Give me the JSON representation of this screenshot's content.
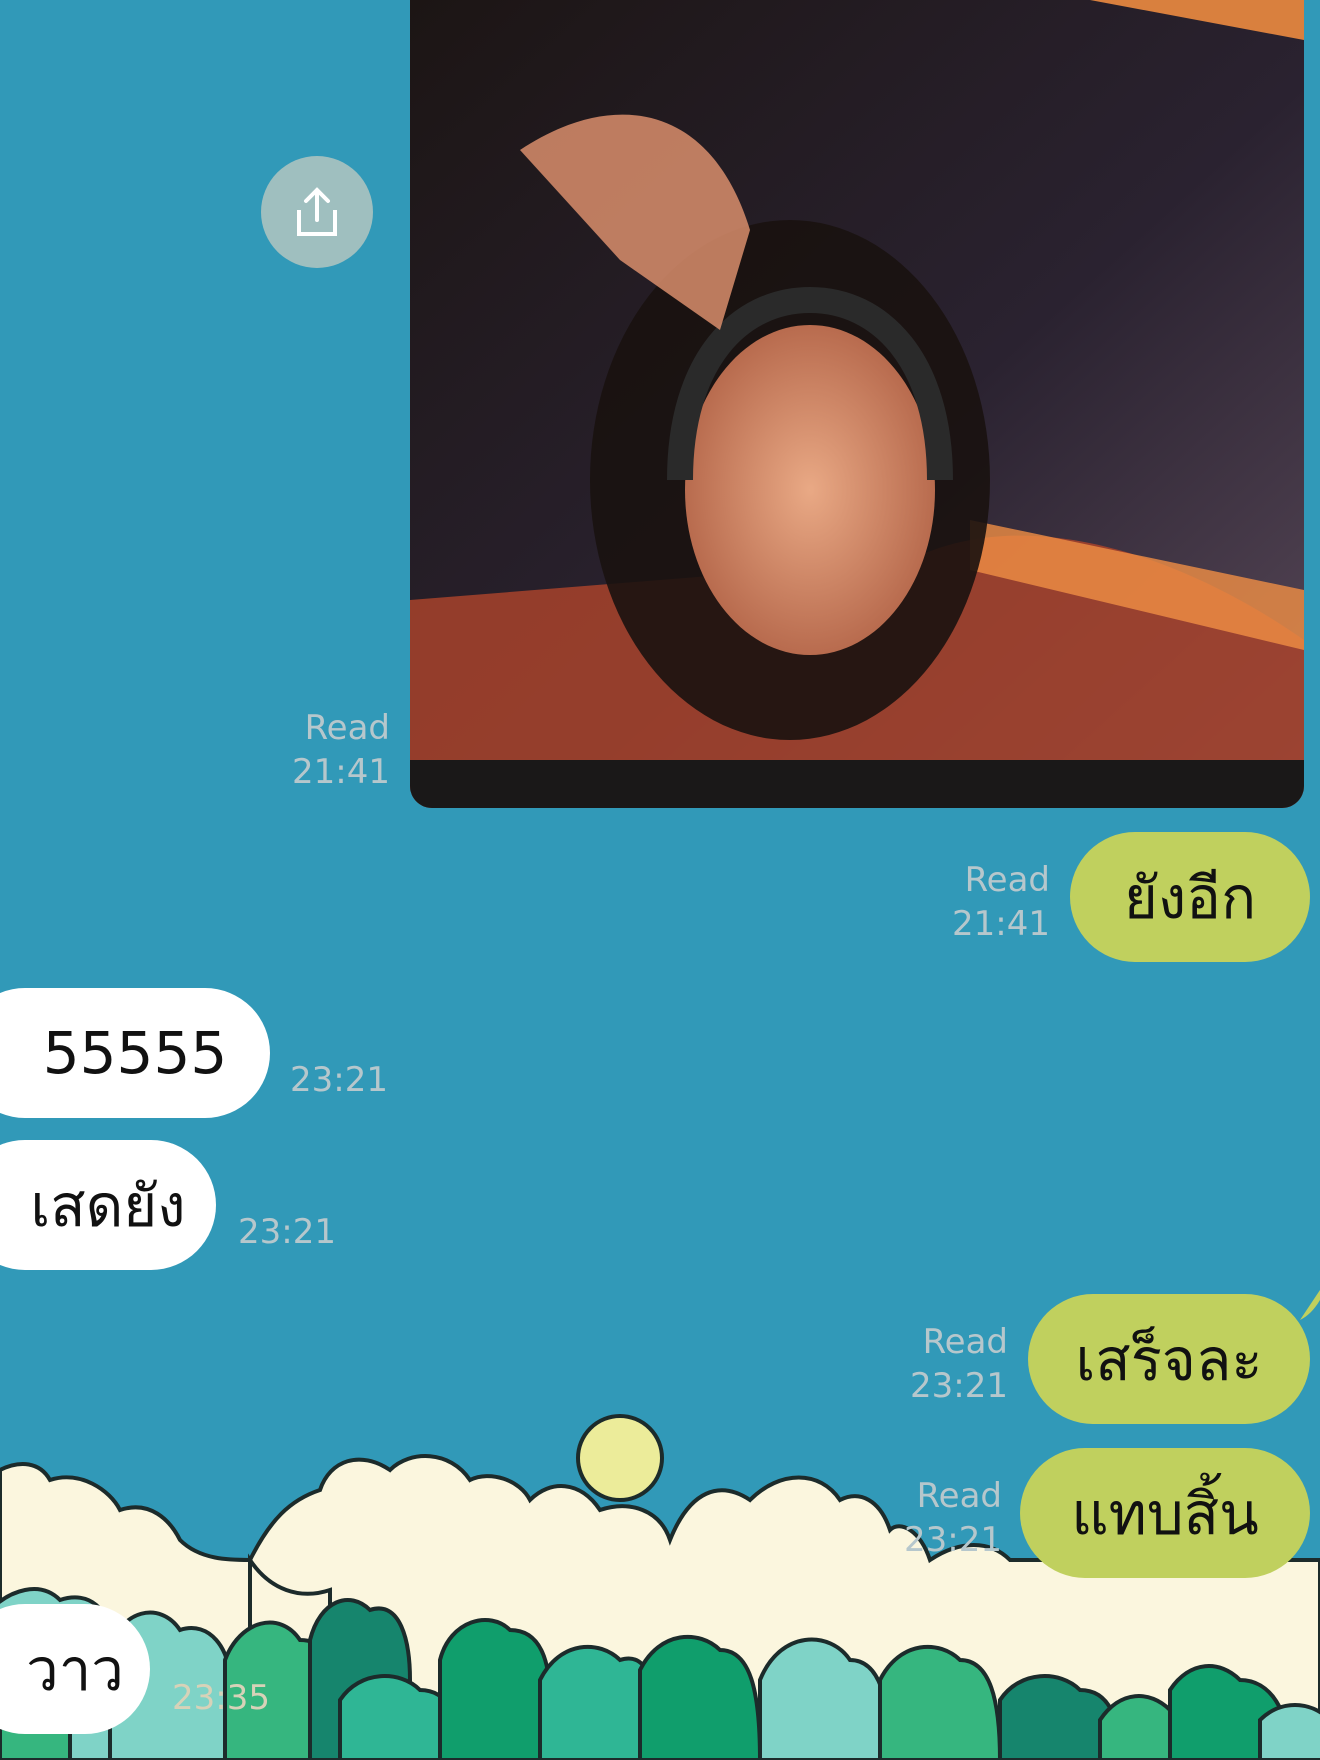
{
  "colors": {
    "background": "#3199b8",
    "outgoing_bubble": "#c0d05e",
    "incoming_bubble": "#ffffff",
    "meta_text": "#b6c7cc"
  },
  "icons": {
    "share": "share-up-arrow-icon"
  },
  "messages": [
    {
      "id": "photo",
      "direction": "outgoing",
      "type": "image",
      "status": "Read",
      "time": "21:41"
    },
    {
      "id": "m1",
      "direction": "outgoing",
      "text": "ยังอีก",
      "status": "Read",
      "time": "21:41"
    },
    {
      "id": "m2",
      "direction": "incoming",
      "text": "55555",
      "time": "23:21"
    },
    {
      "id": "m3",
      "direction": "incoming",
      "text": "เสดยัง",
      "time": "23:21"
    },
    {
      "id": "m4",
      "direction": "outgoing",
      "text": "เสร็จละ",
      "status": "Read",
      "time": "23:21"
    },
    {
      "id": "m5",
      "direction": "outgoing",
      "text": "แทบสิ้น",
      "status": "Read",
      "time": "23:21"
    },
    {
      "id": "m6",
      "direction": "incoming",
      "text": "วาว",
      "time": "23:35"
    }
  ]
}
